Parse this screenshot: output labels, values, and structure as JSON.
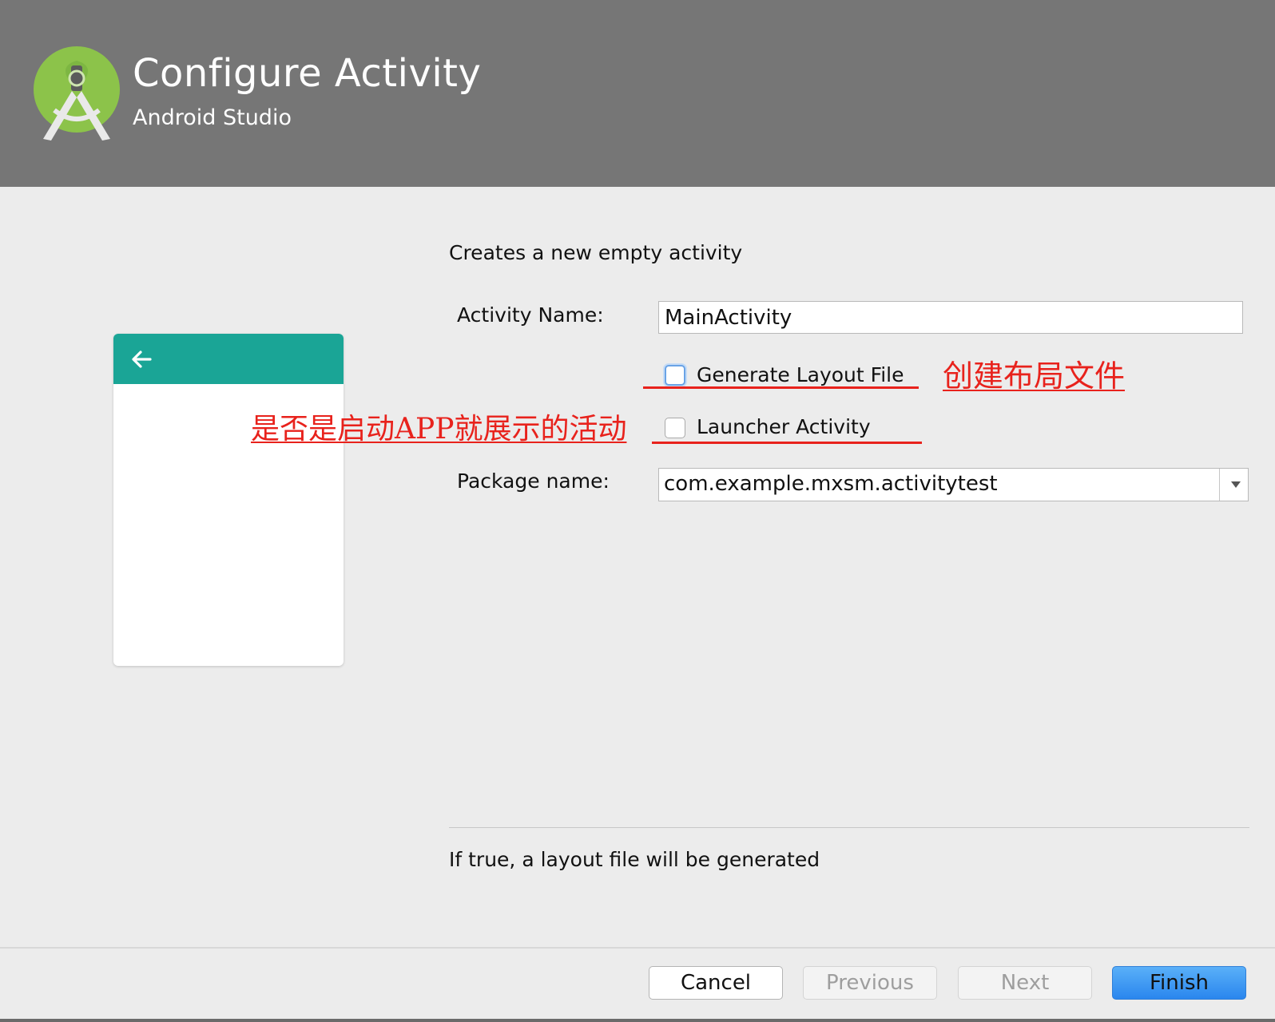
{
  "header": {
    "title": "Configure Activity",
    "subtitle": "Android Studio",
    "background": "#767676",
    "logo_icon": "android-studio-logo-icon"
  },
  "preview": {
    "appbar_color": "#1aa596",
    "back_icon": "arrow-back-icon"
  },
  "form": {
    "description": "Creates a new empty activity",
    "activity_name_label": "Activity Name:",
    "activity_name_value": "MainActivity",
    "generate_layout_label": "Generate Layout File",
    "generate_layout_checked": false,
    "launcher_activity_label": "Launcher Activity",
    "launcher_activity_checked": false,
    "package_name_label": "Package name:",
    "package_name_value": "com.example.mxsm.activitytest"
  },
  "annotations": {
    "generate_layout_note": "创建布局文件",
    "launcher_note": "是否是启动APP就展示的活动",
    "color": "#e8221c"
  },
  "help_text": "If true, a layout file will be generated",
  "buttons": {
    "cancel": "Cancel",
    "previous": "Previous",
    "next": "Next",
    "finish": "Finish"
  }
}
